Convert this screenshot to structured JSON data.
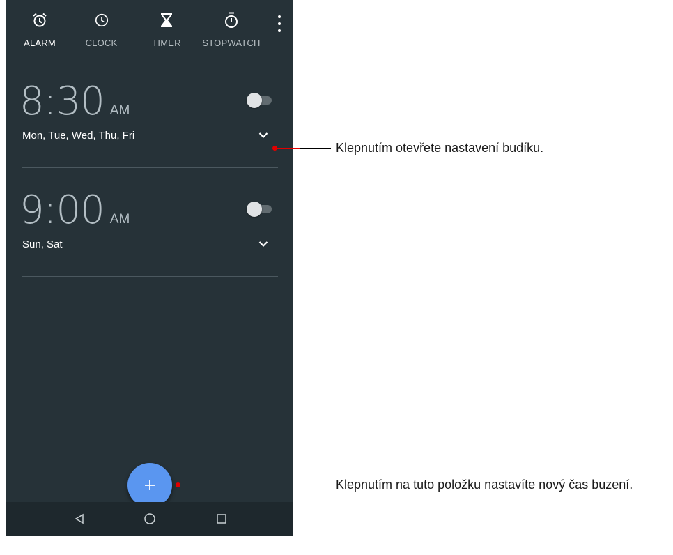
{
  "tabs": [
    {
      "label": "ALARM",
      "icon": "alarm-clock-icon",
      "active": true
    },
    {
      "label": "CLOCK",
      "icon": "clock-icon",
      "active": false
    },
    {
      "label": "TIMER",
      "icon": "hourglass-icon",
      "active": false
    },
    {
      "label": "STOPWATCH",
      "icon": "stopwatch-icon",
      "active": false
    }
  ],
  "alarms": [
    {
      "time": "8:30",
      "ampm": "AM",
      "days": "Mon, Tue, Wed, Thu, Fri",
      "enabled": false
    },
    {
      "time": "9:00",
      "ampm": "AM",
      "days": "Sun, Sat",
      "enabled": false
    }
  ],
  "fab": {
    "icon": "plus-icon"
  },
  "navbar": {
    "icons": [
      "back-icon",
      "home-icon",
      "recents-icon"
    ]
  },
  "callouts": {
    "expand": "Klepnutím otevřete nastavení budíku.",
    "add": "Klepnutím na tuto položku nastavíte nový čas buzení."
  },
  "colors": {
    "background": "#263238",
    "accent": "#5a96f0",
    "callout": "#e10000"
  }
}
